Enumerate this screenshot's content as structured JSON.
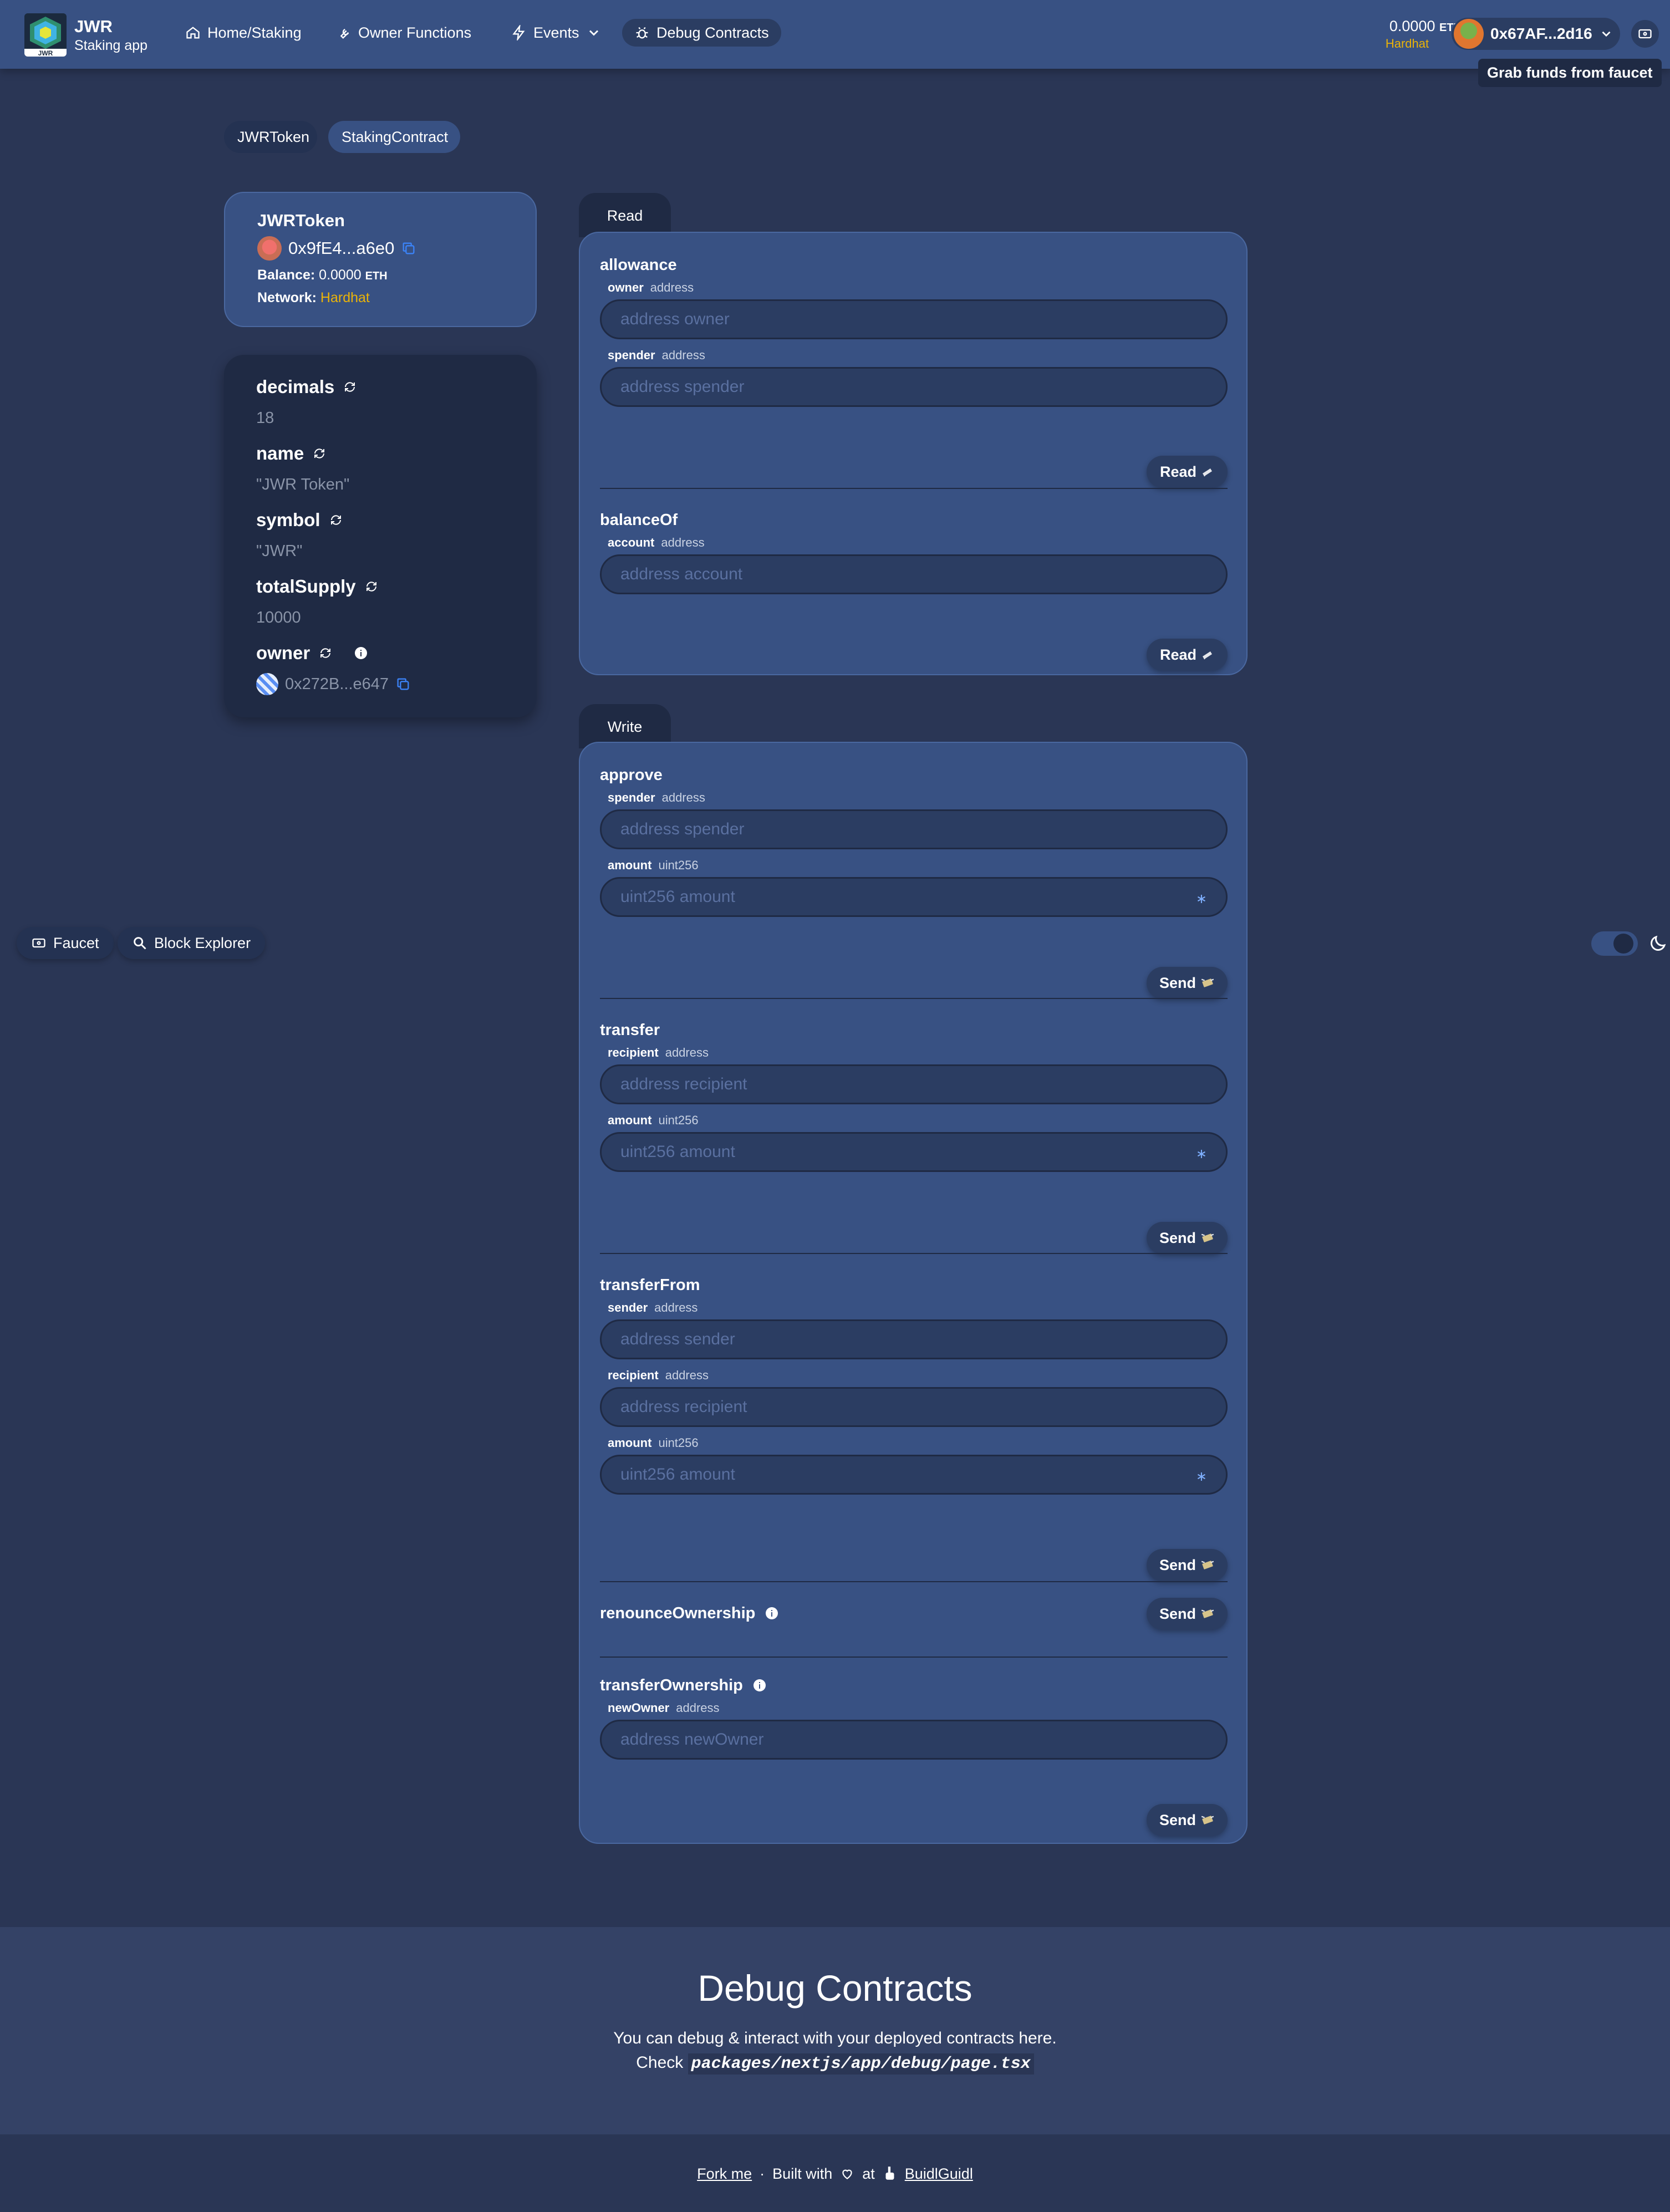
{
  "header": {
    "brand_title": "JWR",
    "brand_sub": "Staking app",
    "logo_text": "JWR",
    "nav": [
      {
        "label": "Home/Staking",
        "icon": "home-icon"
      },
      {
        "label": "Owner Functions",
        "icon": "wrench-icon"
      },
      {
        "label": "Events",
        "icon": "bolt-icon"
      },
      {
        "label": "Debug Contracts",
        "icon": "bug-icon"
      }
    ],
    "eth_balance": "0.0000",
    "eth_unit": "ETH",
    "network": "Hardhat",
    "account": "0x67AF...2d16",
    "tooltip": "Grab funds from faucet"
  },
  "contract_tabs": [
    "JWRToken",
    "StakingContract"
  ],
  "info_card": {
    "title": "JWRToken",
    "address": "0x9fE4...a6e0",
    "balance_label": "Balance:",
    "balance_value": "0.0000",
    "balance_unit": "ETH",
    "network_label": "Network:",
    "network_value": "Hardhat"
  },
  "variables": [
    {
      "name": "decimals",
      "value": "18"
    },
    {
      "name": "name",
      "value": "\"JWR Token\""
    },
    {
      "name": "symbol",
      "value": "\"JWR\""
    },
    {
      "name": "totalSupply",
      "value": "10000"
    },
    {
      "name": "owner",
      "value": "0x272B...e647"
    }
  ],
  "read": {
    "tab_label": "Read",
    "button_label": "Read",
    "functions": [
      {
        "name": "allowance",
        "args": [
          {
            "name": "owner",
            "type": "address",
            "placeholder": "address owner"
          },
          {
            "name": "spender",
            "type": "address",
            "placeholder": "address spender"
          }
        ]
      },
      {
        "name": "balanceOf",
        "args": [
          {
            "name": "account",
            "type": "address",
            "placeholder": "address account"
          }
        ]
      }
    ]
  },
  "write": {
    "tab_label": "Write",
    "button_label": "Send",
    "functions": [
      {
        "name": "approve",
        "args": [
          {
            "name": "spender",
            "type": "address",
            "placeholder": "address spender"
          },
          {
            "name": "amount",
            "type": "uint256",
            "placeholder": "uint256 amount",
            "star": "∗"
          }
        ]
      },
      {
        "name": "transfer",
        "args": [
          {
            "name": "recipient",
            "type": "address",
            "placeholder": "address recipient"
          },
          {
            "name": "amount",
            "type": "uint256",
            "placeholder": "uint256 amount",
            "star": "∗"
          }
        ]
      },
      {
        "name": "transferFrom",
        "args": [
          {
            "name": "sender",
            "type": "address",
            "placeholder": "address sender"
          },
          {
            "name": "recipient",
            "type": "address",
            "placeholder": "address recipient"
          },
          {
            "name": "amount",
            "type": "uint256",
            "placeholder": "uint256 amount",
            "star": "∗"
          }
        ]
      },
      {
        "name": "renounceOwnership",
        "args": []
      },
      {
        "name": "transferOwnership",
        "args": [
          {
            "name": "newOwner",
            "type": "address",
            "placeholder": "address newOwner"
          }
        ]
      }
    ]
  },
  "side_buttons": {
    "faucet": "Faucet",
    "explorer": "Block Explorer"
  },
  "hero": {
    "title": "Debug Contracts",
    "line1": "You can debug & interact with your deployed contracts here.",
    "line2_prefix": "Check",
    "code": "packages/nextjs/app/debug/page.tsx"
  },
  "footer": {
    "fork": "Fork me",
    "sep": "·",
    "built_with": "Built with",
    "at": "at",
    "buidl": "BuidlGuidl"
  }
}
